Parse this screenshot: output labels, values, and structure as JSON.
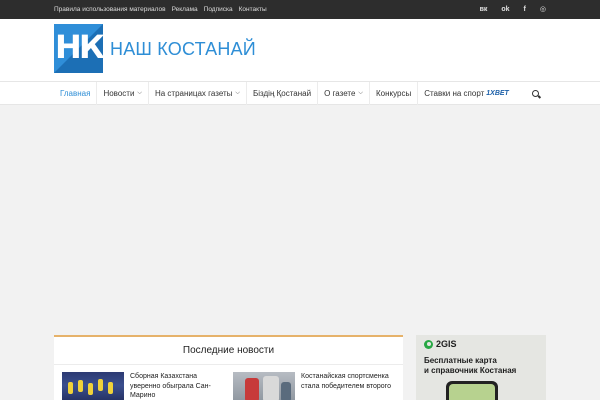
{
  "topbar": {
    "links": [
      "Правила использования материалов",
      "Реклама",
      "Подписка",
      "Контакты"
    ],
    "social": [
      {
        "icon": "vk-icon",
        "glyph": "вк"
      },
      {
        "icon": "odnoklassniki-icon",
        "glyph": "ok"
      },
      {
        "icon": "facebook-icon",
        "glyph": "f"
      },
      {
        "icon": "instagram-icon",
        "glyph": "◎"
      }
    ]
  },
  "header": {
    "logo_letters": "НК",
    "site_title": "НАШ КОСТАНАЙ"
  },
  "nav": {
    "items": [
      {
        "label": "Главная",
        "active": true,
        "dropdown": false
      },
      {
        "label": "Новости",
        "active": false,
        "dropdown": true
      },
      {
        "label": "На страницах газеты",
        "active": false,
        "dropdown": true
      },
      {
        "label": "Біздің Қостанай",
        "active": false,
        "dropdown": false
      },
      {
        "label": "О газете",
        "active": false,
        "dropdown": true
      },
      {
        "label": "Конкурсы",
        "active": false,
        "dropdown": false
      },
      {
        "label": "Ставки на спорт",
        "active": false,
        "dropdown": false,
        "badge": "1XBET"
      }
    ],
    "search_icon": "search-icon"
  },
  "news": {
    "title": "Последние новости",
    "cards": [
      {
        "caption": "Сборная Казахстана уверенно обыграла Сан-Марино"
      },
      {
        "caption": "Костанайская спортсменка стала победителем второго"
      }
    ]
  },
  "side_ad": {
    "brand": "2GIS",
    "line1": "Бесплатные карта",
    "line2": "и справочник Костаная"
  },
  "colors": {
    "accent": "#2e8ed6",
    "topbar": "#2d2d2d",
    "news_border": "#e6b26a",
    "gis_green": "#27a844"
  }
}
